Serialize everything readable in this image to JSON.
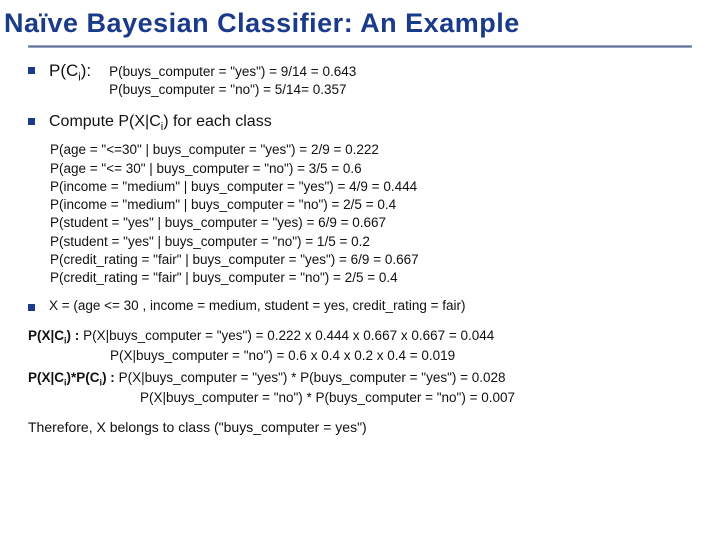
{
  "title": "Naïve Bayesian Classifier:  An Example",
  "section1": {
    "label_html": "P(C<span class='sub'>i</span>):",
    "line1": "P(buys_computer = \"yes\")  = 9/14 = 0.643",
    "line2": "P(buys_computer = \"no\") = 5/14= 0.357"
  },
  "section2": {
    "label_html": "Compute P(X|C<span class='sub'>i</span>) for each class",
    "lines": [
      "P(age = \"<=30\" | buys_computer = \"yes\")  = 2/9 = 0.222",
      "P(age = \"<= 30\" | buys_computer = \"no\") = 3/5 = 0.6",
      "P(income = \"medium\" | buys_computer = \"yes\") = 4/9 = 0.444",
      "P(income = \"medium\" | buys_computer = \"no\") = 2/5 = 0.4",
      "P(student = \"yes\" | buys_computer = \"yes) = 6/9 = 0.667",
      "P(student = \"yes\" | buys_computer = \"no\") = 1/5 = 0.2",
      "P(credit_rating = \"fair\" | buys_computer = \"yes\") = 6/9 = 0.667",
      "P(credit_rating = \"fair\" | buys_computer = \"no\") = 2/5 = 0.4"
    ]
  },
  "section3": {
    "label": "X = (age <= 30 , income = medium, student = yes, credit_rating = fair)"
  },
  "pxci_label": "P(X|C",
  "pxci_line1": "P(X|buys_computer = \"yes\") = 0.222 x 0.444 x 0.667 x 0.667 = 0.044",
  "pxci_line2": "P(X|buys_computer = \"no\") = 0.6 x 0.4 x 0.2 x 0.4 = 0.019",
  "pxcipci_label": "P(X|C",
  "pxcipci_line1": "P(X|buys_computer = \"yes\") * P(buys_computer = \"yes\") = 0.028",
  "pxcipci_line2": "P(X|buys_computer = \"no\") * P(buys_computer = \"no\") = 0.007",
  "conclusion": "Therefore,  X belongs to class (\"buys_computer = yes\")"
}
